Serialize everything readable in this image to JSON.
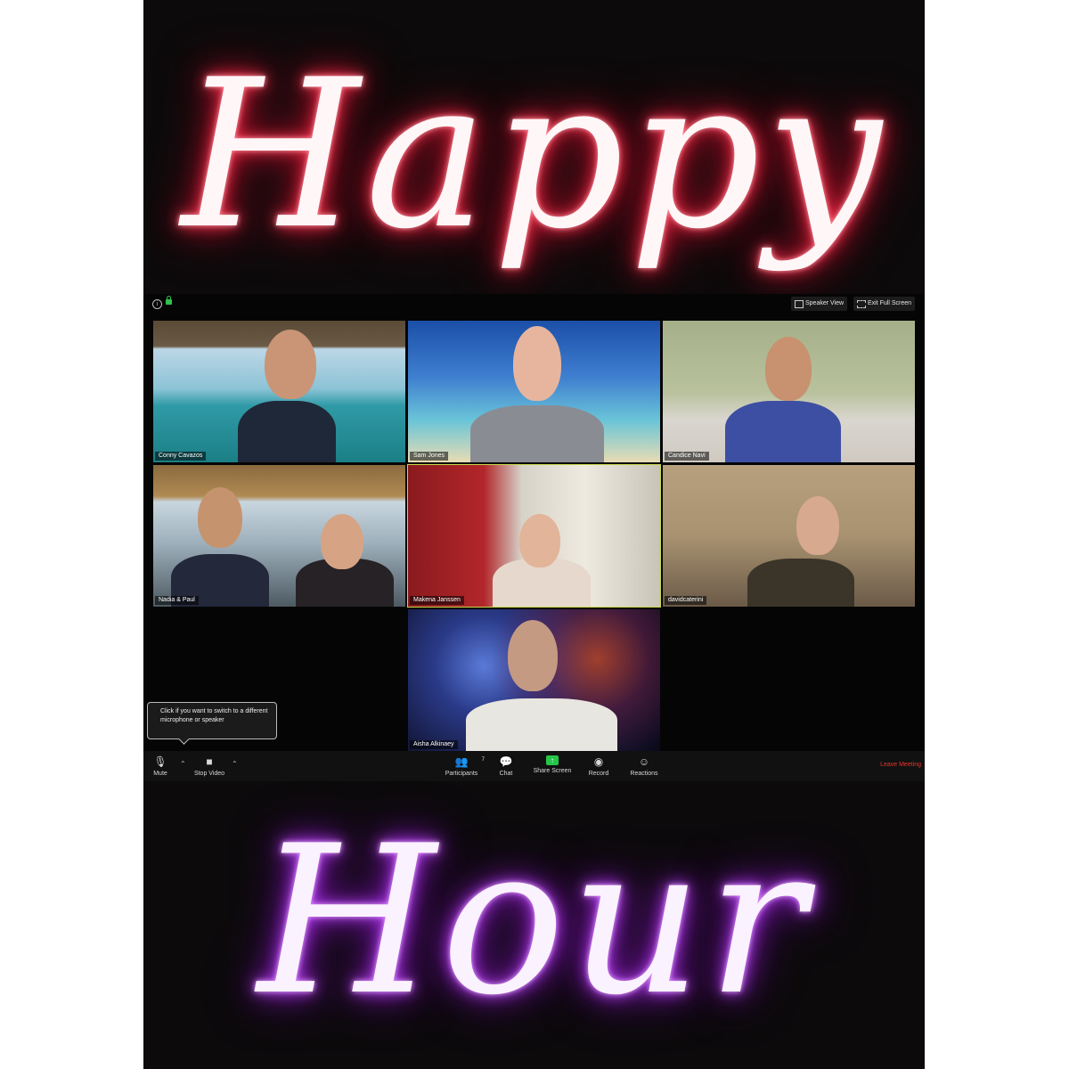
{
  "poster": {
    "headline_top": "Happy",
    "headline_bottom": "Hour",
    "colors": {
      "top_glow": "#ff3b55",
      "bottom_glow": "#c04cff"
    }
  },
  "meeting": {
    "top_bar": {
      "info_icon": "info-icon",
      "lock_icon": "lock-icon",
      "speaker_view_label": "Speaker View",
      "exit_full_screen_label": "Exit Full Screen"
    },
    "participants": [
      {
        "name": "Conny Cavazos",
        "scene": "beach-hut"
      },
      {
        "name": "Sam Jones",
        "scene": "palm-beach"
      },
      {
        "name": "Candice Navi",
        "scene": "bedroom"
      },
      {
        "name": "Nadia & Paul",
        "scene": "tiki-bar"
      },
      {
        "name": "Makena Janssen",
        "scene": "red-curtain",
        "active_speaker": true
      },
      {
        "name": "davidcaterini",
        "scene": "bedroom-closet"
      },
      {
        "name": "Aisha Alkinaey",
        "scene": "galaxy"
      }
    ],
    "tooltip": "Click if you want to switch to a different microphone or speaker",
    "toolbar": {
      "mute_label": "Mute",
      "stop_video_label": "Stop Video",
      "participants_label": "Participants",
      "participants_count": "7",
      "chat_label": "Chat",
      "share_screen_label": "Share Screen",
      "record_label": "Record",
      "reactions_label": "Reactions",
      "leave_label": "Leave Meeting"
    },
    "colors": {
      "active_border": "#c8d84a",
      "leave": "#e8352e",
      "share": "#26c54a"
    }
  }
}
